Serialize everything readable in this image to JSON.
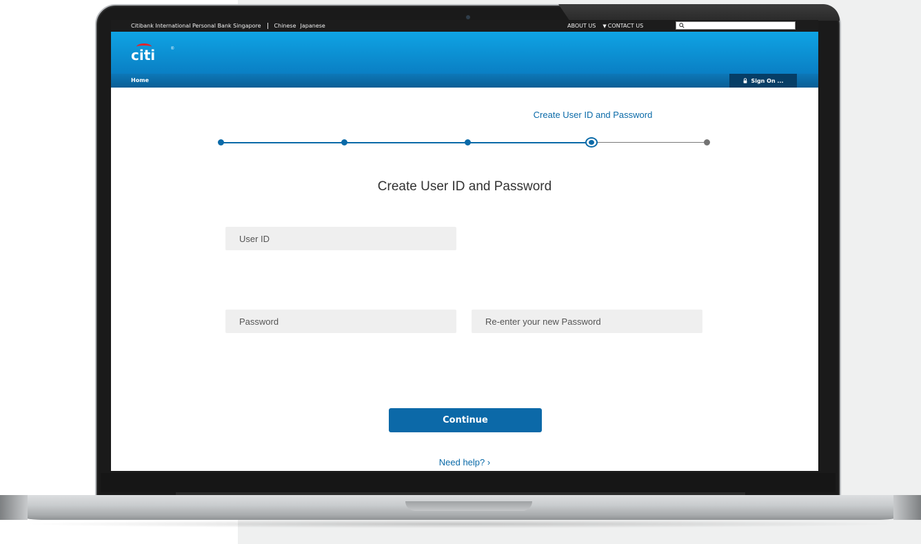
{
  "utility_bar": {
    "site_name": "Citibank International Personal Bank Singapore",
    "languages": [
      "Chinese",
      "Japanese"
    ],
    "about_us": "ABOUT US",
    "contact_us": "CONTACT US",
    "search_placeholder": ""
  },
  "brand": {
    "logo_text": "citi",
    "logo_mark": "®"
  },
  "nav": {
    "home": "Home",
    "sign_on": "Sign On ..."
  },
  "stepper": {
    "current_step_label": "Create User ID and Password",
    "total_steps": 5,
    "current_step": 4
  },
  "form": {
    "title": "Create User ID and Password",
    "user_id_placeholder": "User ID",
    "password_placeholder": "Password",
    "confirm_password_placeholder": "Re-enter your new Password",
    "continue_label": "Continue",
    "help_link": "Need help? ›"
  },
  "colors": {
    "brand_blue": "#0a6aa8",
    "header_gradient_top": "#0fa4e4",
    "logo_arc_red": "#e2242b"
  }
}
